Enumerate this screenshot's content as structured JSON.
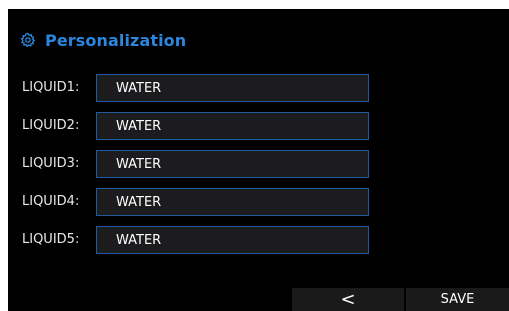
{
  "header": {
    "title": "Personalization",
    "icon": "gear-icon",
    "accent_color": "#2a86de"
  },
  "liquids": [
    {
      "label": "LIQUID1:",
      "value": "WATER"
    },
    {
      "label": "LIQUID2:",
      "value": "WATER"
    },
    {
      "label": "LIQUID3:",
      "value": "WATER"
    },
    {
      "label": "LIQUID4:",
      "value": "WATER"
    },
    {
      "label": "LIQUID5:",
      "value": "WATER"
    }
  ],
  "footer": {
    "back_label": "<",
    "save_label": "SAVE"
  }
}
